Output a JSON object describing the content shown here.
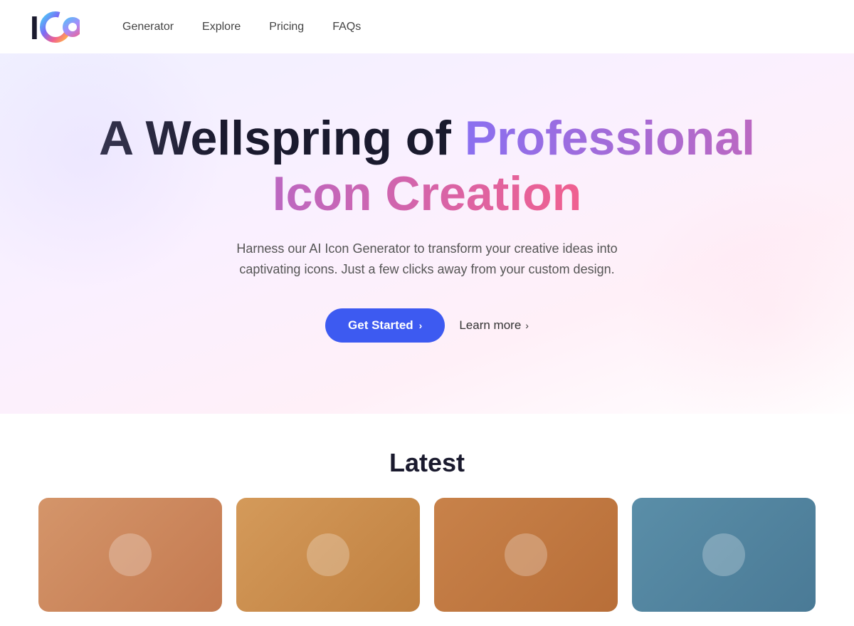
{
  "logo": {
    "alt": "ICO Logo"
  },
  "nav": {
    "links": [
      {
        "label": "Generator",
        "href": "#"
      },
      {
        "label": "Explore",
        "href": "#"
      },
      {
        "label": "Pricing",
        "href": "#"
      },
      {
        "label": "FAQs",
        "href": "#"
      }
    ]
  },
  "hero": {
    "title_plain": "A Wellspring of ",
    "title_gradient": "Professional Icon Creation",
    "subtitle": "Harness our AI Icon Generator to transform your creative ideas into captivating icons. Just a few clicks away from your custom design.",
    "cta_primary": "Get Started",
    "cta_secondary": "Learn more"
  },
  "latest": {
    "section_title": "Latest",
    "cards": [
      {
        "id": "card-1",
        "bg": "#c47a50"
      },
      {
        "id": "card-2",
        "bg": "#c08040"
      },
      {
        "id": "card-3",
        "bg": "#b86e38"
      },
      {
        "id": "card-4",
        "bg": "#4a7a96"
      }
    ]
  }
}
